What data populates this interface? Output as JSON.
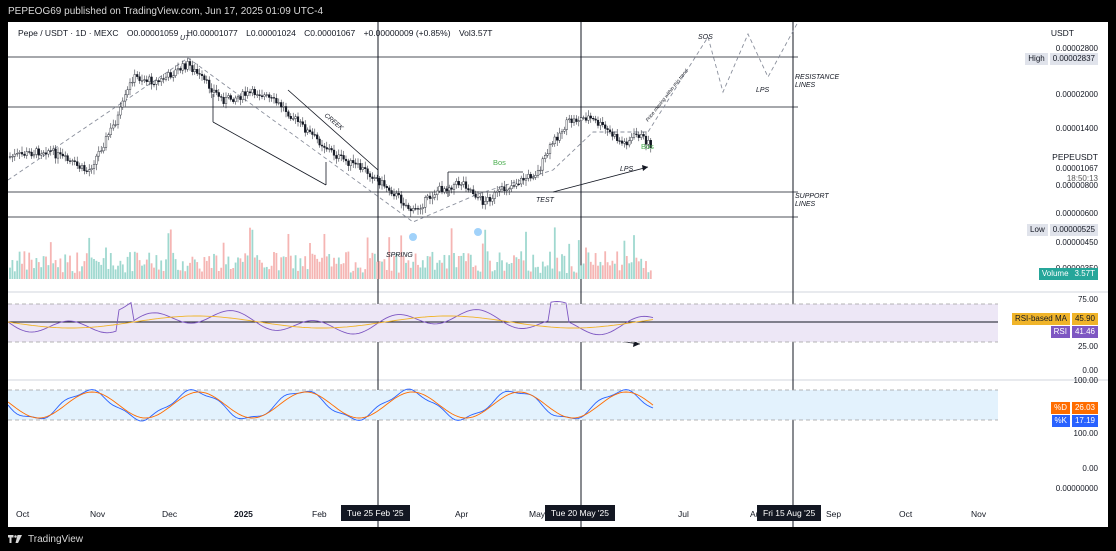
{
  "header": {
    "publish_line": "PEPEOG69 published on TradingView.com, Jun 17, 2025 01:09 UTC-4"
  },
  "legend": {
    "symbol": "Pepe / USDT · 1D · MEXC",
    "open": "O0.00001059",
    "high": "H0.00001077",
    "low": "L0.00001024",
    "close": "C0.00001067",
    "change": "+0.00000009 (+0.85%)",
    "volume": "Vol3.57T"
  },
  "price_axis": {
    "currency": "USDT",
    "ticks": [
      "0.00002800",
      "0.00002000",
      "0.00001400",
      "0.00000800",
      "0.00000600",
      "0.00000450",
      "0.00000350"
    ],
    "high_label": "High",
    "high_value": "0.00002837",
    "symbol_label": "PEPEUSDT",
    "last_price": "0.00001067",
    "countdown": "18:50:13",
    "low_label": "Low",
    "low_value": "0.00000525",
    "volume_label": "Volume",
    "volume_value": "3.57T"
  },
  "rsi_axis": {
    "ticks": [
      "75.00",
      "25.00",
      "0.00"
    ],
    "ma_label": "RSI-based MA",
    "ma_value": "45.90",
    "rsi_label": "RSI",
    "rsi_value": "41.46"
  },
  "stoch_axis": {
    "ticks": [
      "100.00",
      "100.00",
      "0.00",
      "0.00000000"
    ],
    "d_label": "%D",
    "d_value": "26.03",
    "k_label": "%K",
    "k_value": "17.19"
  },
  "annotations": {
    "ut": "UT",
    "creek": "CREEK",
    "spring": "SPRING",
    "bos1": "Bos",
    "test": "TEST",
    "bos2": "Bos",
    "lps1": "LPS",
    "sos": "SOS",
    "lps2": "LPS",
    "resistance": "RESISTANCE LINES",
    "support": "SUPPORT LINES",
    "markup_note": "Price moving within this trend"
  },
  "time_axis": {
    "labels": [
      "Oct",
      "Nov",
      "Dec",
      "2025",
      "Feb",
      "Apr",
      "May",
      "Jul",
      "Au",
      "Sep",
      "Oct",
      "Nov"
    ],
    "highlight_1": "Tue 25 Feb '25",
    "highlight_2": "Tue 20 May '25",
    "highlight_3": "Fri 15 Aug '25"
  },
  "footer": {
    "brand": "TradingView"
  },
  "colors": {
    "up": "#26a69a",
    "down": "#ef5350",
    "rsi": "#7e57c2",
    "rsi_ma": "#f0b429",
    "rsi_band": "#ede7f6",
    "stoch_k": "#2962ff",
    "stoch_d": "#ff6d00",
    "stoch_band": "#e3f2fd",
    "volume_badge": "#26a69a",
    "bos_text": "#4caf50"
  }
}
